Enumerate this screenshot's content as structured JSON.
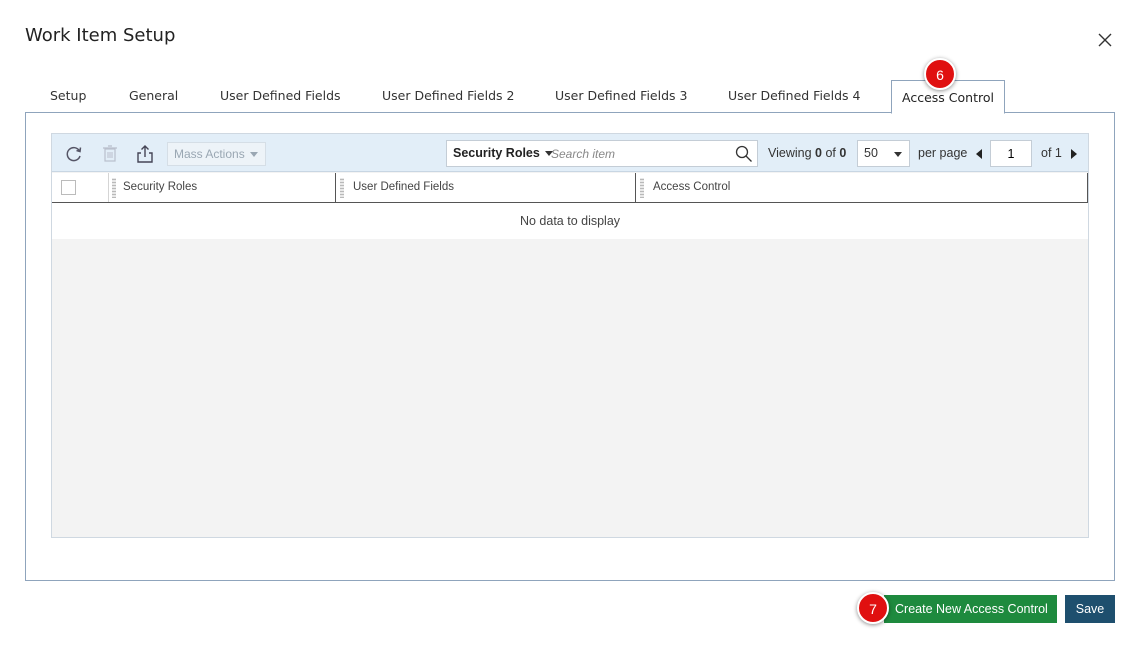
{
  "dialog": {
    "title": "Work Item Setup",
    "close_icon": "close-icon"
  },
  "tabs": [
    {
      "label": "Setup"
    },
    {
      "label": "General"
    },
    {
      "label": "User Defined Fields"
    },
    {
      "label": "User Defined Fields 2"
    },
    {
      "label": "User Defined Fields 3"
    },
    {
      "label": "User Defined Fields 4"
    },
    {
      "label": "Access Control",
      "active": true
    }
  ],
  "annotations": {
    "tab_badge": "6",
    "button_badge": "7",
    "badge_color": "#e01010"
  },
  "toolbar": {
    "icons": [
      "refresh-icon",
      "delete-icon",
      "export-icon"
    ],
    "mass_actions": "Mass Actions",
    "search_field": "Security Roles",
    "search_placeholder": "Search item",
    "viewing_prefix": "Viewing",
    "viewing_from": "0",
    "viewing_of": "of",
    "viewing_total": "0",
    "per_page_value": "50",
    "per_page_label": "per page",
    "page_value": "1",
    "page_of": "of 1"
  },
  "grid": {
    "columns": [
      "Security Roles",
      "User Defined Fields",
      "Access Control"
    ],
    "empty_message": "No data to display"
  },
  "footer": {
    "create_label": "Create New Access Control",
    "save_label": "Save",
    "create_color": "#1e8a3e",
    "save_color": "#1e4f6e"
  }
}
